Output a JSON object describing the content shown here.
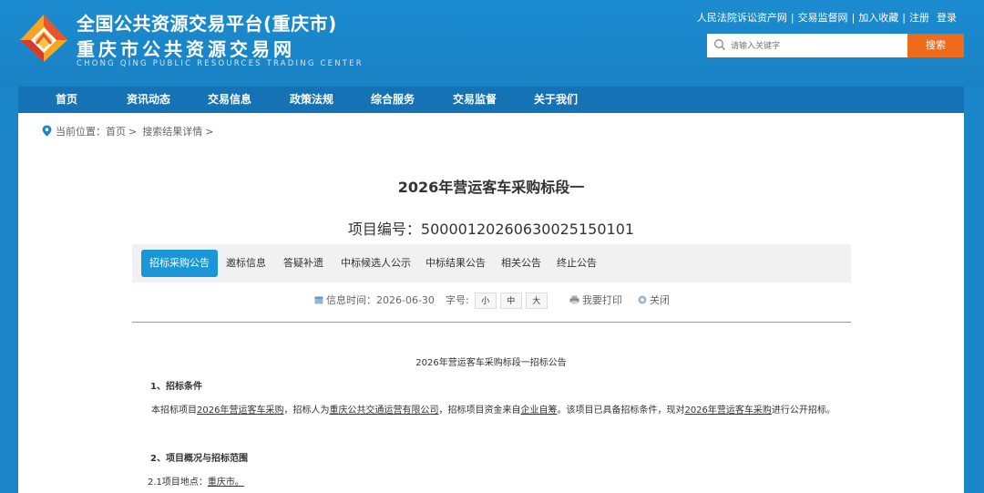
{
  "site": {
    "title": "全国公共资源交易平台(重庆市)",
    "subtitle": "重庆市公共资源交易网",
    "subtitle_en": "CHONG QING PUBLIC RESOURCES TRADING CENTER"
  },
  "toplinks": [
    "人民法院诉讼资产网",
    "交易监督网",
    "加入收藏",
    "注册",
    "登录"
  ],
  "search": {
    "placeholder": "请输入关键字",
    "button": "搜索"
  },
  "nav": [
    "首页",
    "资讯动态",
    "交易信息",
    "政策法规",
    "综合服务",
    "交易监督",
    "关于我们"
  ],
  "breadcrumb": {
    "label": "当前位置：",
    "items": [
      "首页",
      "搜索结果详情"
    ]
  },
  "article": {
    "title": "2026年营运客车采购标段一",
    "project_no": "项目编号：500001202606300251501​01"
  },
  "tabs": [
    "招标采购公告",
    "邀标信息",
    "答疑补遗",
    "中标候选人公示",
    "中标结果公告",
    "相关公告",
    "终止公告"
  ],
  "info": {
    "time_label": "信息时间：",
    "time_value": "2026-06-30",
    "font_label": "字号:",
    "font_sizes": [
      "小",
      "中",
      "大"
    ],
    "print": "我要打印",
    "close": "关闭"
  },
  "doc": {
    "heading": "2026年营运客车采购标段一招标公告",
    "sec1": "1、招标条件",
    "p1": {
      "a": "本招标项目",
      "project": "2026年营运客车采购",
      "b": "，招标人为",
      "tenderer": "重庆公共交通运营有限公司",
      "c": "，招标项目资金来自",
      "fund": "企业自筹",
      "d": "。该项目已具备招标条件，现对",
      "project2": "2026年营运客车采购",
      "e": "进行公开招标。"
    },
    "sec2": "2、项目概况与招标范围",
    "loc_label": "2.1项目地点：",
    "loc_value": "重庆市。"
  },
  "colors": {
    "header_bg": "#1a86c9",
    "nav_bg": "#1572b4",
    "accent": "#1a97d6",
    "search_btn": "#f06a1c"
  }
}
